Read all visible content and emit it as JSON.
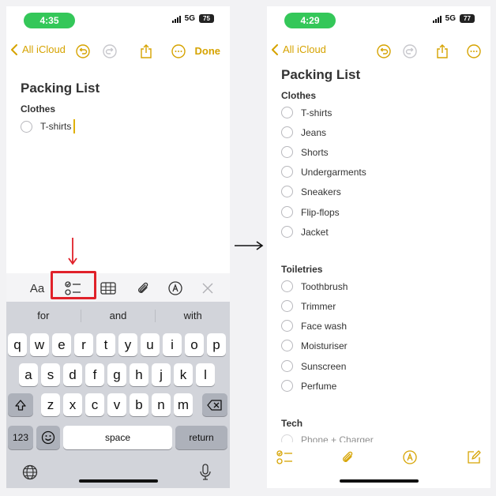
{
  "left": {
    "status": {
      "time": "4:35",
      "network": "5G",
      "battery": "75"
    },
    "nav": {
      "back_label": "All iCloud",
      "done_label": "Done"
    },
    "note": {
      "title": "Packing List",
      "section": "Clothes",
      "item": "T-shirts"
    },
    "toolbar": {
      "text_format_label": "Aa"
    },
    "keyboard": {
      "predictions": [
        "for",
        "and",
        "with"
      ],
      "row1": [
        "q",
        "w",
        "e",
        "r",
        "t",
        "y",
        "u",
        "i",
        "o",
        "p"
      ],
      "row2": [
        "a",
        "s",
        "d",
        "f",
        "g",
        "h",
        "j",
        "k",
        "l"
      ],
      "row3": [
        "z",
        "x",
        "c",
        "v",
        "b",
        "n",
        "m"
      ],
      "numbers_label": "123",
      "space_label": "space",
      "return_label": "return"
    }
  },
  "right": {
    "status": {
      "time": "4:29",
      "network": "5G",
      "battery": "77"
    },
    "nav": {
      "back_label": "All iCloud"
    },
    "note": {
      "title": "Packing List",
      "sections": [
        {
          "heading": "Clothes",
          "items": [
            "T-shirts",
            "Jeans",
            "Shorts",
            "Undergarments",
            "Sneakers",
            "Flip-flops",
            "Jacket"
          ]
        },
        {
          "heading": "Toiletries",
          "items": [
            "Toothbrush",
            "Trimmer",
            "Face wash",
            "Moisturiser",
            "Sunscreen",
            "Perfume"
          ]
        },
        {
          "heading": "Tech",
          "items": [
            "Phone + Charger"
          ]
        }
      ]
    }
  },
  "colors": {
    "accent": "#d6a300",
    "time_pill": "#34c759",
    "highlight": "#e0212a",
    "keyboard_bg": "#d2d4da"
  }
}
